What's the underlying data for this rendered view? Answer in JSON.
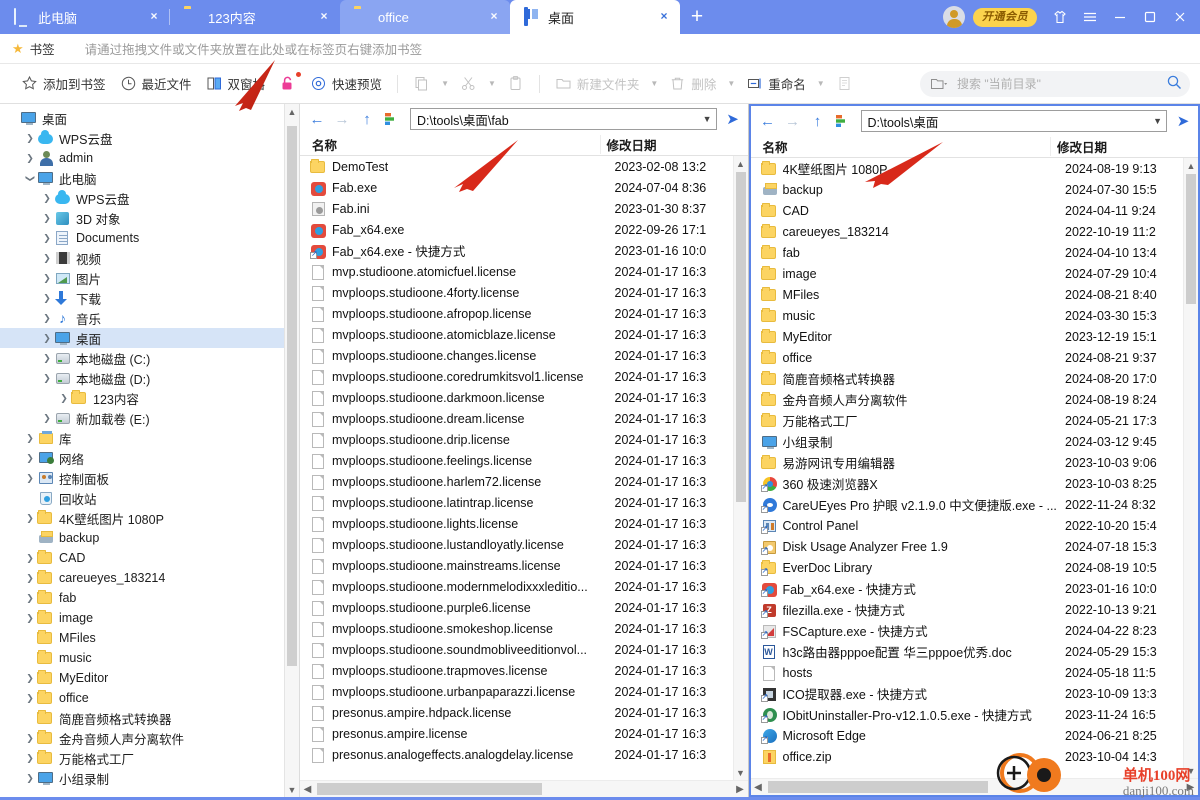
{
  "window": {
    "tabs": [
      {
        "label": "此电脑",
        "icon": "monitor-icon",
        "state": "inactive"
      },
      {
        "label": "123内容",
        "icon": "folder-icon",
        "state": "inactive"
      },
      {
        "label": "office",
        "icon": "folder-icon",
        "state": "highlight"
      },
      {
        "label": "桌面",
        "icon": "dual-pane-icon",
        "state": "active"
      }
    ],
    "new_tab_label": "+",
    "close_label": "×",
    "vip_label": "开通会员",
    "accent": "#6c8ced",
    "active_tab_bg": "#ffffff"
  },
  "bookmarks": {
    "star_icon": "star-icon",
    "label": "书签",
    "hint": "请通过拖拽文件或文件夹放置在此处或在标签页右键添加书签"
  },
  "toolbar": {
    "items": [
      {
        "name": "add-to-bookmarks",
        "label": "添加到书签",
        "icon": "star-outline-icon",
        "disabled": false,
        "caret": false
      },
      {
        "name": "recent-files",
        "label": "最近文件",
        "icon": "clock-icon",
        "disabled": false,
        "caret": false
      },
      {
        "name": "dual-pane",
        "label": "双窗格",
        "icon": "dual-pane-icon",
        "disabled": false,
        "caret": false
      },
      {
        "name": "unlock",
        "label": "",
        "icon": "unlock-icon",
        "disabled": false,
        "caret": false
      },
      {
        "name": "quick-preview",
        "label": "快速预览",
        "icon": "eye-icon",
        "disabled": false,
        "caret": false
      },
      {
        "name": "copy",
        "label": "",
        "icon": "copy-icon",
        "disabled": true,
        "caret": true
      },
      {
        "name": "cut",
        "label": "",
        "icon": "scissors-icon",
        "disabled": true,
        "caret": true
      },
      {
        "name": "paste",
        "label": "",
        "icon": "clipboard-icon",
        "disabled": true,
        "caret": false
      },
      {
        "name": "new-folder",
        "label": "新建文件夹",
        "icon": "folder-outline-icon",
        "disabled": true,
        "caret": true
      },
      {
        "name": "delete",
        "label": "删除",
        "icon": "trash-icon",
        "disabled": true,
        "caret": true
      },
      {
        "name": "rename",
        "label": "重命名",
        "icon": "rename-icon",
        "disabled": false,
        "caret": true
      },
      {
        "name": "properties",
        "label": "",
        "icon": "properties-icon",
        "disabled": true,
        "caret": false
      }
    ],
    "search": {
      "icon": "folder-scope-icon",
      "placeholder": "搜索 \"当前目录\"",
      "search_icon": "search-icon"
    }
  },
  "sidebar": {
    "items": [
      {
        "label": "桌面",
        "icon": "monitor-icon",
        "indent": 0,
        "twist": "",
        "selected": false
      },
      {
        "label": "WPS云盘",
        "icon": "cloud-icon",
        "indent": 1,
        "twist": ">",
        "selected": false
      },
      {
        "label": "admin",
        "icon": "user-icon",
        "indent": 1,
        "twist": ">",
        "selected": false
      },
      {
        "label": "此电脑",
        "icon": "monitor-icon",
        "indent": 1,
        "twist": "v",
        "selected": false
      },
      {
        "label": "WPS云盘",
        "icon": "cloud-icon",
        "indent": 2,
        "twist": ">",
        "selected": false
      },
      {
        "label": "3D 对象",
        "icon": "cube-icon",
        "indent": 2,
        "twist": ">",
        "selected": false
      },
      {
        "label": "Documents",
        "icon": "documents-icon",
        "indent": 2,
        "twist": ">",
        "selected": false
      },
      {
        "label": "视频",
        "icon": "video-icon",
        "indent": 2,
        "twist": ">",
        "selected": false
      },
      {
        "label": "图片",
        "icon": "picture-icon",
        "indent": 2,
        "twist": ">",
        "selected": false
      },
      {
        "label": "下载",
        "icon": "download-icon",
        "indent": 2,
        "twist": ">",
        "selected": false
      },
      {
        "label": "音乐",
        "icon": "music-icon",
        "indent": 2,
        "twist": ">",
        "selected": false
      },
      {
        "label": "桌面",
        "icon": "monitor-icon",
        "indent": 2,
        "twist": ">",
        "selected": true
      },
      {
        "label": "本地磁盘 (C:)",
        "icon": "drive-icon",
        "indent": 2,
        "twist": ">",
        "selected": false
      },
      {
        "label": "本地磁盘 (D:)",
        "icon": "drive-icon",
        "indent": 2,
        "twist": ">",
        "selected": false
      },
      {
        "label": "123内容",
        "icon": "folder-icon",
        "indent": 3,
        "twist": ">",
        "selected": false
      },
      {
        "label": "新加载卷 (E:)",
        "icon": "drive-icon",
        "indent": 2,
        "twist": ">",
        "selected": false
      },
      {
        "label": "库",
        "icon": "library-icon",
        "indent": 1,
        "twist": ">",
        "selected": false
      },
      {
        "label": "网络",
        "icon": "network-icon",
        "indent": 1,
        "twist": ">",
        "selected": false
      },
      {
        "label": "控制面板",
        "icon": "control-panel-icon",
        "indent": 1,
        "twist": ">",
        "selected": false
      },
      {
        "label": "回收站",
        "icon": "recycle-bin-icon",
        "indent": 1,
        "twist": "",
        "selected": false
      },
      {
        "label": "4K壁纸图片 1080P",
        "icon": "folder-icon",
        "indent": 1,
        "twist": ">",
        "selected": false
      },
      {
        "label": "backup",
        "icon": "shared-folder-icon",
        "indent": 1,
        "twist": "",
        "selected": false
      },
      {
        "label": "CAD",
        "icon": "folder-icon",
        "indent": 1,
        "twist": ">",
        "selected": false
      },
      {
        "label": "careueyes_183214",
        "icon": "folder-icon",
        "indent": 1,
        "twist": ">",
        "selected": false
      },
      {
        "label": "fab",
        "icon": "folder-icon",
        "indent": 1,
        "twist": ">",
        "selected": false
      },
      {
        "label": "image",
        "icon": "folder-icon",
        "indent": 1,
        "twist": ">",
        "selected": false
      },
      {
        "label": "MFiles",
        "icon": "folder-icon",
        "indent": 1,
        "twist": "",
        "selected": false
      },
      {
        "label": "music",
        "icon": "folder-icon",
        "indent": 1,
        "twist": "",
        "selected": false
      },
      {
        "label": "MyEditor",
        "icon": "folder-icon",
        "indent": 1,
        "twist": ">",
        "selected": false
      },
      {
        "label": "office",
        "icon": "folder-icon",
        "indent": 1,
        "twist": ">",
        "selected": false
      },
      {
        "label": "简鹿音频格式转换器",
        "icon": "folder-icon",
        "indent": 1,
        "twist": "",
        "selected": false
      },
      {
        "label": "金舟音频人声分离软件",
        "icon": "folder-icon",
        "indent": 1,
        "twist": ">",
        "selected": false
      },
      {
        "label": "万能格式工厂",
        "icon": "folder-icon",
        "indent": 1,
        "twist": ">",
        "selected": false
      },
      {
        "label": "小组录制",
        "icon": "monitor-icon",
        "indent": 1,
        "twist": ">",
        "selected": false
      }
    ]
  },
  "left_pane": {
    "nav": {
      "back": "←",
      "forward": "→",
      "up": "↑",
      "history": "history-icon",
      "go": "go-icon"
    },
    "address": "D:\\tools\\桌面\\fab",
    "columns": {
      "name": "名称",
      "date": "修改日期"
    },
    "rows": [
      {
        "name": "DemoTest",
        "icon": "folder-icon",
        "date": "2023-02-08 13:2"
      },
      {
        "name": "Fab.exe",
        "icon": "exe-icon",
        "date": "2024-07-04 8:36"
      },
      {
        "name": "Fab.ini",
        "icon": "ini-icon",
        "date": "2023-01-30 8:37"
      },
      {
        "name": "Fab_x64.exe",
        "icon": "exe-icon",
        "date": "2022-09-26 17:1"
      },
      {
        "name": "Fab_x64.exe - 快捷方式",
        "icon": "exe-shortcut-icon",
        "date": "2023-01-16 10:0"
      },
      {
        "name": "mvp.studioone.atomicfuel.license",
        "icon": "file-icon",
        "date": "2024-01-17 16:3"
      },
      {
        "name": "mvploops.studioone.4forty.license",
        "icon": "file-icon",
        "date": "2024-01-17 16:3"
      },
      {
        "name": "mvploops.studioone.afropop.license",
        "icon": "file-icon",
        "date": "2024-01-17 16:3"
      },
      {
        "name": "mvploops.studioone.atomicblaze.license",
        "icon": "file-icon",
        "date": "2024-01-17 16:3"
      },
      {
        "name": "mvploops.studioone.changes.license",
        "icon": "file-icon",
        "date": "2024-01-17 16:3"
      },
      {
        "name": "mvploops.studioone.coredrumkitsvol1.license",
        "icon": "file-icon",
        "date": "2024-01-17 16:3"
      },
      {
        "name": "mvploops.studioone.darkmoon.license",
        "icon": "file-icon",
        "date": "2024-01-17 16:3"
      },
      {
        "name": "mvploops.studioone.dream.license",
        "icon": "file-icon",
        "date": "2024-01-17 16:3"
      },
      {
        "name": "mvploops.studioone.drip.license",
        "icon": "file-icon",
        "date": "2024-01-17 16:3"
      },
      {
        "name": "mvploops.studioone.feelings.license",
        "icon": "file-icon",
        "date": "2024-01-17 16:3"
      },
      {
        "name": "mvploops.studioone.harlem72.license",
        "icon": "file-icon",
        "date": "2024-01-17 16:3"
      },
      {
        "name": "mvploops.studioone.latintrap.license",
        "icon": "file-icon",
        "date": "2024-01-17 16:3"
      },
      {
        "name": "mvploops.studioone.lights.license",
        "icon": "file-icon",
        "date": "2024-01-17 16:3"
      },
      {
        "name": "mvploops.studioone.lustandloyatly.license",
        "icon": "file-icon",
        "date": "2024-01-17 16:3"
      },
      {
        "name": "mvploops.studioone.mainstreams.license",
        "icon": "file-icon",
        "date": "2024-01-17 16:3"
      },
      {
        "name": "mvploops.studioone.modernmelodixxxleditio...",
        "icon": "file-icon",
        "date": "2024-01-17 16:3"
      },
      {
        "name": "mvploops.studioone.purple6.license",
        "icon": "file-icon",
        "date": "2024-01-17 16:3"
      },
      {
        "name": "mvploops.studioone.smokeshop.license",
        "icon": "file-icon",
        "date": "2024-01-17 16:3"
      },
      {
        "name": "mvploops.studioone.soundmobliveeditionvol...",
        "icon": "file-icon",
        "date": "2024-01-17 16:3"
      },
      {
        "name": "mvploops.studioone.trapmoves.license",
        "icon": "file-icon",
        "date": "2024-01-17 16:3"
      },
      {
        "name": "mvploops.studioone.urbanpaparazzi.license",
        "icon": "file-icon",
        "date": "2024-01-17 16:3"
      },
      {
        "name": "presonus.ampire.hdpack.license",
        "icon": "file-icon",
        "date": "2024-01-17 16:3"
      },
      {
        "name": "presonus.ampire.license",
        "icon": "file-icon",
        "date": "2024-01-17 16:3"
      },
      {
        "name": "presonus.analogeffects.analogdelay.license",
        "icon": "file-icon",
        "date": "2024-01-17 16:3"
      }
    ]
  },
  "right_pane": {
    "nav": {
      "back": "←",
      "forward": "→",
      "up": "↑",
      "history": "history-icon",
      "go": "go-icon"
    },
    "address": "D:\\tools\\桌面",
    "columns": {
      "name": "名称",
      "date": "修改日期"
    },
    "rows": [
      {
        "name": "4K壁纸图片 1080P",
        "icon": "folder-icon",
        "date": "2024-08-19 9:13"
      },
      {
        "name": "backup",
        "icon": "shared-folder-icon",
        "date": "2024-07-30 15:5"
      },
      {
        "name": "CAD",
        "icon": "folder-icon",
        "date": "2024-04-11 9:24"
      },
      {
        "name": "careueyes_183214",
        "icon": "folder-icon",
        "date": "2022-10-19 11:2"
      },
      {
        "name": "fab",
        "icon": "folder-icon",
        "date": "2024-04-10 13:4"
      },
      {
        "name": "image",
        "icon": "folder-icon",
        "date": "2024-07-29 10:4"
      },
      {
        "name": "MFiles",
        "icon": "folder-icon",
        "date": "2024-08-21 8:40"
      },
      {
        "name": "music",
        "icon": "folder-icon",
        "date": "2024-03-30 15:3"
      },
      {
        "name": "MyEditor",
        "icon": "folder-icon",
        "date": "2023-12-19 15:1"
      },
      {
        "name": "office",
        "icon": "folder-icon",
        "date": "2024-08-21 9:37"
      },
      {
        "name": "简鹿音频格式转换器",
        "icon": "folder-icon",
        "date": "2024-08-20 17:0"
      },
      {
        "name": "金舟音频人声分离软件",
        "icon": "folder-icon",
        "date": "2024-08-19 8:24"
      },
      {
        "name": "万能格式工厂",
        "icon": "folder-icon",
        "date": "2024-05-21 17:3"
      },
      {
        "name": "小组录制",
        "icon": "monitor-icon",
        "date": "2024-03-12 9:45"
      },
      {
        "name": "易游网讯专用编辑器",
        "icon": "folder-icon",
        "date": "2023-10-03 9:06"
      },
      {
        "name": "360 极速浏览器X",
        "icon": "chrome-icon",
        "date": "2023-10-03 8:25"
      },
      {
        "name": "CareUEyes Pro 护眼 v2.1.9.0 中文便捷版.exe - ...",
        "icon": "eye-shortcut-icon",
        "date": "2022-11-24 8:32"
      },
      {
        "name": "Control Panel",
        "icon": "control-panel-shortcut-icon",
        "date": "2022-10-20 15:4"
      },
      {
        "name": "Disk Usage Analyzer Free 1.9",
        "icon": "disk-analyzer-icon",
        "date": "2024-07-18 15:3"
      },
      {
        "name": "EverDoc Library",
        "icon": "folder-shortcut-icon",
        "date": "2024-08-19 10:5"
      },
      {
        "name": "Fab_x64.exe - 快捷方式",
        "icon": "exe-shortcut-icon",
        "date": "2023-01-16 10:0"
      },
      {
        "name": "filezilla.exe - 快捷方式",
        "icon": "filezilla-icon",
        "date": "2022-10-13 9:21"
      },
      {
        "name": "FSCapture.exe - 快捷方式",
        "icon": "fscapture-icon",
        "date": "2024-04-22 8:23"
      },
      {
        "name": "h3c路由器pppoe配置 华三pppoe优秀.doc",
        "icon": "word-doc-icon",
        "date": "2024-05-29 15:3"
      },
      {
        "name": "hosts",
        "icon": "file-icon",
        "date": "2024-05-18 11:5"
      },
      {
        "name": "ICO提取器.exe - 快捷方式",
        "icon": "ico-extractor-icon",
        "date": "2023-10-09 13:3"
      },
      {
        "name": "IObitUninstaller-Pro-v12.1.0.5.exe - 快捷方式",
        "icon": "iobit-icon",
        "date": "2023-11-24 16:5"
      },
      {
        "name": "Microsoft Edge",
        "icon": "edge-icon",
        "date": "2024-06-21 8:25"
      },
      {
        "name": "office.zip",
        "icon": "zip-icon",
        "date": "2023-10-04 14:3"
      }
    ]
  },
  "watermark": {
    "title": "单机100网",
    "site": "danji100.com"
  }
}
